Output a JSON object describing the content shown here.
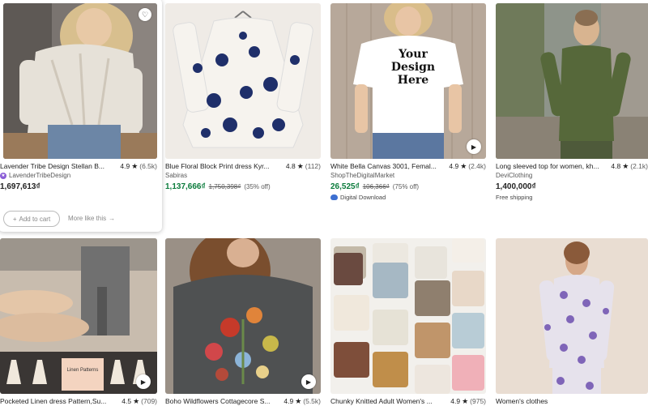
{
  "listings": [
    {
      "title": "Lavender Tribe Design Stellan B...",
      "rating": "4.9",
      "reviews": "(6.5k)",
      "shop": "LavenderTribeDesign",
      "price": "1,697,613₫",
      "colors": {
        "bg": "#6f6a66"
      }
    },
    {
      "title": "Blue Floral Block Print dress Kyr...",
      "rating": "4.8",
      "reviews": "(112)",
      "shop": "Sabiras",
      "price": "1,137,666₫",
      "orig_price": "1,750,398₫",
      "discount": "(35% off)"
    },
    {
      "title": "White Bella Canvas 3001, Femal...",
      "rating": "4.9",
      "reviews": "(2.4k)",
      "shop": "ShopTheDigitalMarket",
      "price": "26,525₫",
      "orig_price": "106,366₫",
      "discount": "(75% off)",
      "extra": "Digital Download",
      "shirt_text": "Your Design Here"
    },
    {
      "title": "Long sleeved top for women, kh...",
      "rating": "4.8",
      "reviews": "(2.1k)",
      "shop": "DeviClothing",
      "price": "1,400,000₫",
      "extra": "Free shipping"
    },
    {
      "title": "Pocketed Linen dress Pattern,Su...",
      "rating": "4.5",
      "reviews": "(709)"
    },
    {
      "title": "Boho Wildflowers Cottagecore S...",
      "rating": "4.9",
      "reviews": "(5.5k)"
    },
    {
      "title": "Chunky Knitted Adult Women's ...",
      "rating": "4.9",
      "reviews": "(975)"
    },
    {
      "title": "Women's clothes"
    }
  ],
  "hover_actions": {
    "add_to_cart": "Add to cart",
    "more_like_this": "More like this"
  },
  "pattern_badge": "Linen Patterns",
  "colors": {
    "sale_green": "#0a7b3b",
    "star_seller": "#8a5cd6",
    "digital_blue": "#3d6fd1"
  },
  "icons": {
    "favorite": "heart-icon",
    "play": "play-icon",
    "rating": "star-icon"
  }
}
